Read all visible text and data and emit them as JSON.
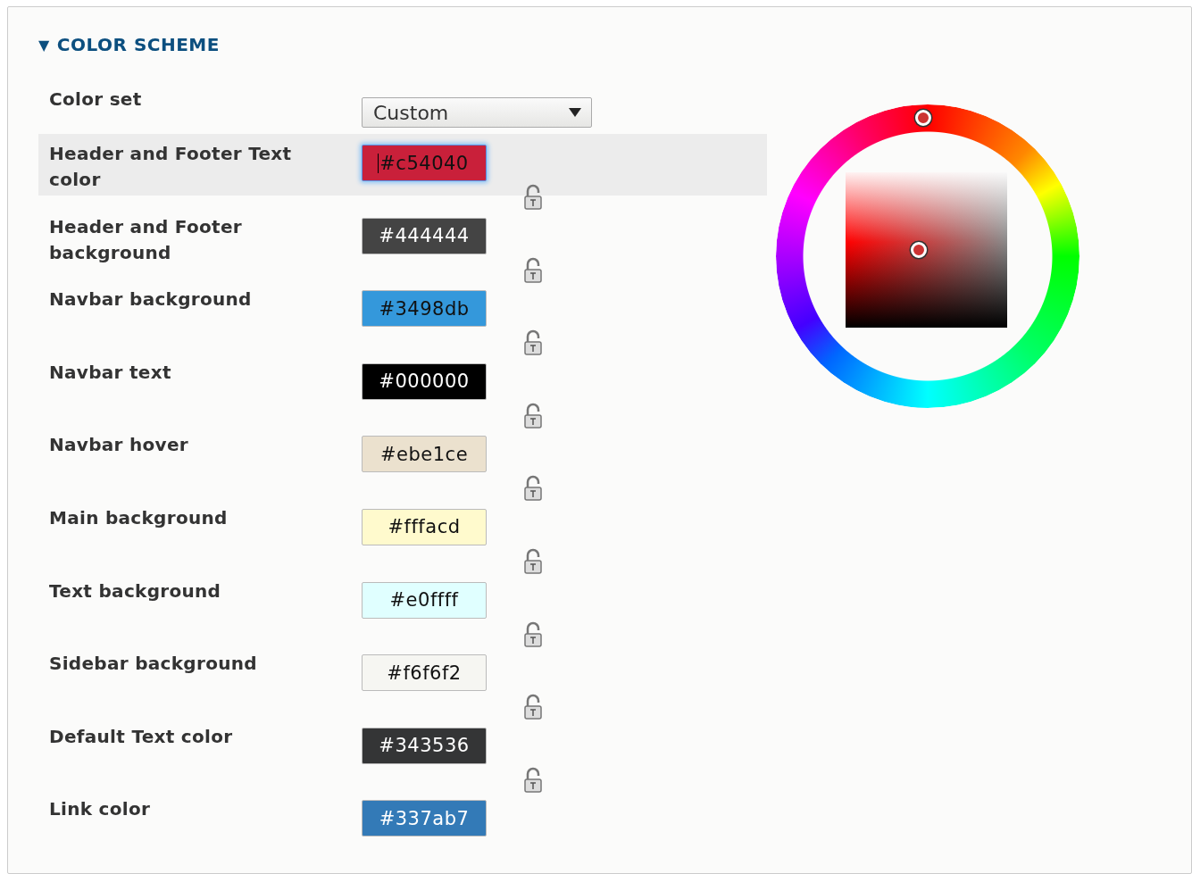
{
  "section": {
    "toggle": "▼",
    "title": "COLOR SCHEME",
    "expanded": true
  },
  "color_set": {
    "label": "Color set",
    "value": "Custom"
  },
  "fields": [
    {
      "label": "Header and Footer Text color",
      "value": "#c54040",
      "color": "#c9203a",
      "selected": true
    },
    {
      "label": "Header and Footer background",
      "value": "#444444",
      "color": "#444444",
      "selected": false
    },
    {
      "label": "Navbar background",
      "value": "#3498db",
      "color": "#3498db",
      "selected": false
    },
    {
      "label": "Navbar text",
      "value": "#000000",
      "color": "#000000",
      "selected": false
    },
    {
      "label": "Navbar hover",
      "value": "#ebe1ce",
      "color": "#ebe1ce",
      "selected": false
    },
    {
      "label": "Main background",
      "value": "#fffacd",
      "color": "#fffacd",
      "selected": false
    },
    {
      "label": "Text background",
      "value": "#e0ffff",
      "color": "#e0ffff",
      "selected": false
    },
    {
      "label": "Sidebar background",
      "value": "#f6f6f2",
      "color": "#f6f6f2",
      "selected": false
    },
    {
      "label": "Default Text color",
      "value": "#343536",
      "color": "#343536",
      "selected": false
    },
    {
      "label": "Link color",
      "value": "#337ab7",
      "color": "#337ab7",
      "selected": false
    }
  ]
}
